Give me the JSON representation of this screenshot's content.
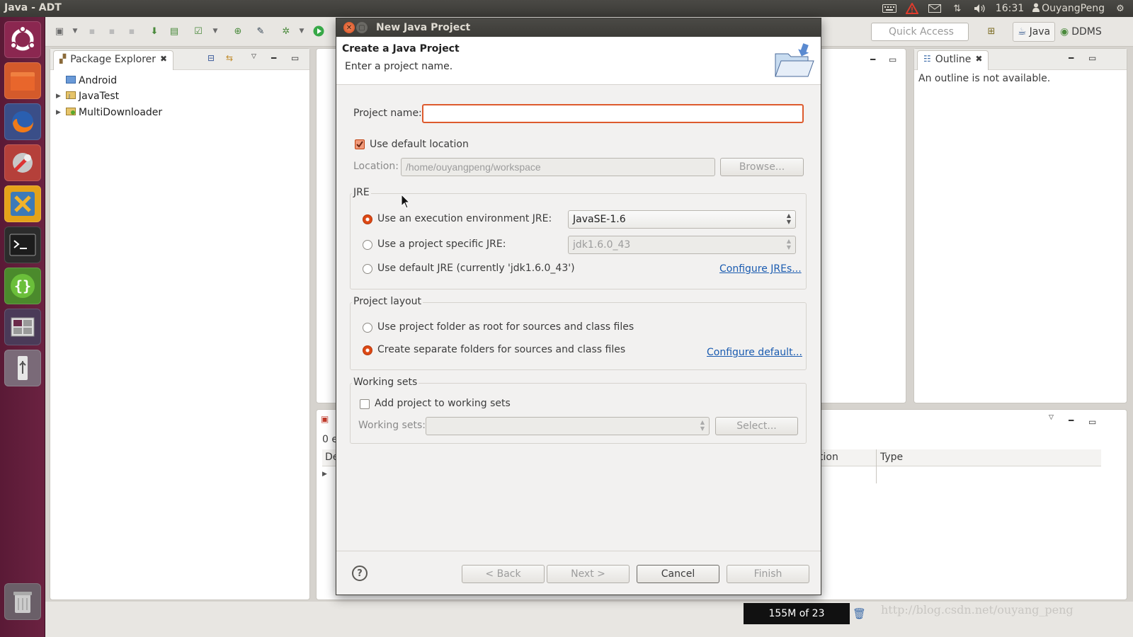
{
  "topbar": {
    "window_title": "Java - ADT",
    "time": "16:31",
    "user": "OuyangPeng",
    "icons": [
      "keyboard-icon",
      "warning-icon",
      "mail-icon",
      "network-icon",
      "volume-icon",
      "user-icon",
      "gear-icon"
    ]
  },
  "launcher": {
    "items": [
      "ubuntu-dash",
      "files",
      "firefox",
      "system-settings",
      "vmware",
      "terminal",
      "brackets-editor",
      "workspace-switcher",
      "usb-drive",
      "trash"
    ]
  },
  "toolbar": {
    "quick_access_placeholder": "Quick Access",
    "perspectives": [
      "Java",
      "DDMS"
    ]
  },
  "package_explorer": {
    "title": "Package Explorer",
    "items": [
      {
        "label": "Android",
        "expandable": false
      },
      {
        "label": "JavaTest",
        "expandable": true
      },
      {
        "label": "MultiDownloader",
        "expandable": true
      }
    ]
  },
  "outline": {
    "title": "Outline",
    "message": "An outline is not available."
  },
  "problems": {
    "count_text": "0 e",
    "col_desc": "De",
    "col_location": "tion",
    "col_type": "Type"
  },
  "dialog": {
    "title": "New Java Project",
    "header_title": "Create a Java Project",
    "header_subtitle": "Enter a project name.",
    "project_name_label": "Project name:",
    "project_name_value": "",
    "use_default_location_label": "Use default location",
    "use_default_location_checked": true,
    "location_label": "Location:",
    "location_value": "/home/ouyangpeng/workspace",
    "browse_label": "Browse...",
    "jre_group": "JRE",
    "jre_exec_env_label": "Use an execution environment JRE:",
    "jre_exec_env_value": "JavaSE-1.6",
    "jre_specific_label": "Use a project specific JRE:",
    "jre_specific_value": "jdk1.6.0_43",
    "jre_default_label": "Use default JRE (currently 'jdk1.6.0_43')",
    "configure_jres": "Configure JREs...",
    "layout_group": "Project layout",
    "layout_root_label": "Use project folder as root for sources and class files",
    "layout_separate_label": "Create separate folders for sources and class files",
    "configure_default": "Configure default...",
    "working_sets_group": "Working sets",
    "add_to_ws_label": "Add project to working sets",
    "working_sets_label": "Working sets:",
    "select_label": "Select...",
    "back_label": "< Back",
    "next_label": "Next >",
    "cancel_label": "Cancel",
    "finish_label": "Finish"
  },
  "status": {
    "heap": "155M of 23",
    "watermark": "http://blog.csdn.net/ouyang_peng"
  },
  "colors": {
    "accent": "#dd4814",
    "link": "#1a5bb0",
    "launcher_bg": "#5a1a36",
    "panel_bg": "#3c3b37"
  }
}
